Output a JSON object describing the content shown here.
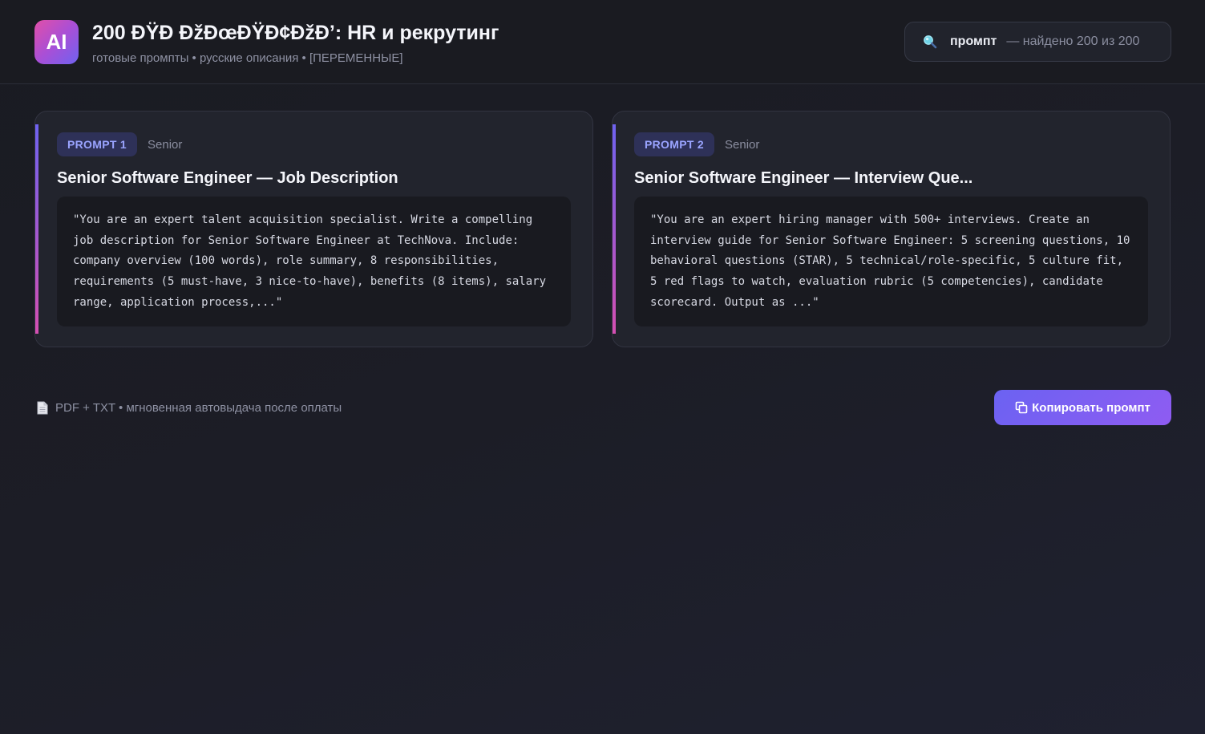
{
  "header": {
    "logo_text": "AI",
    "title": "200 ÐŸÐ ÐžÐœÐŸÐ¢ÐžÐ’: HR и рекрутинг",
    "subtitle": "готовые промпты • русские описания • [ПЕРЕМЕННЫЕ]"
  },
  "search": {
    "icon": "search-icon",
    "term": "промпт",
    "result": "— найдено 200 из 200"
  },
  "cards": [
    {
      "badge": "PROMPT 1",
      "level": "Senior",
      "title": "Senior Software Engineer — Job Description",
      "prompt": "\"You are an expert talent acquisition specialist. Write a compelling job description for Senior Software Engineer at TechNova. Include: company overview (100 words), role summary, 8 responsibilities, requirements (5 must-have, 3 nice-to-have), benefits (8 items), salary range, application process,...\""
    },
    {
      "badge": "PROMPT 2",
      "level": "Senior",
      "title": "Senior Software Engineer — Interview Que...",
      "prompt": "\"You are an expert hiring manager with 500+ interviews. Create an interview guide for Senior Software Engineer: 5 screening questions, 10 behavioral questions (STAR), 5 technical/role-specific, 5 culture fit, 5 red flags to watch, evaluation rubric (5 competencies), candidate scorecard. Output as ...\""
    }
  ],
  "footer": {
    "note_icon": "document-icon",
    "note": "PDF + TXT • мгновенная автовыдача после оплаты",
    "copy_icon": "copy-icon",
    "copy_label": "Копировать промпт"
  },
  "colors": {
    "accent": "#6b62f2",
    "accent_pink": "#d44fb2",
    "background": "#1a1b22",
    "card": "#22242d"
  }
}
